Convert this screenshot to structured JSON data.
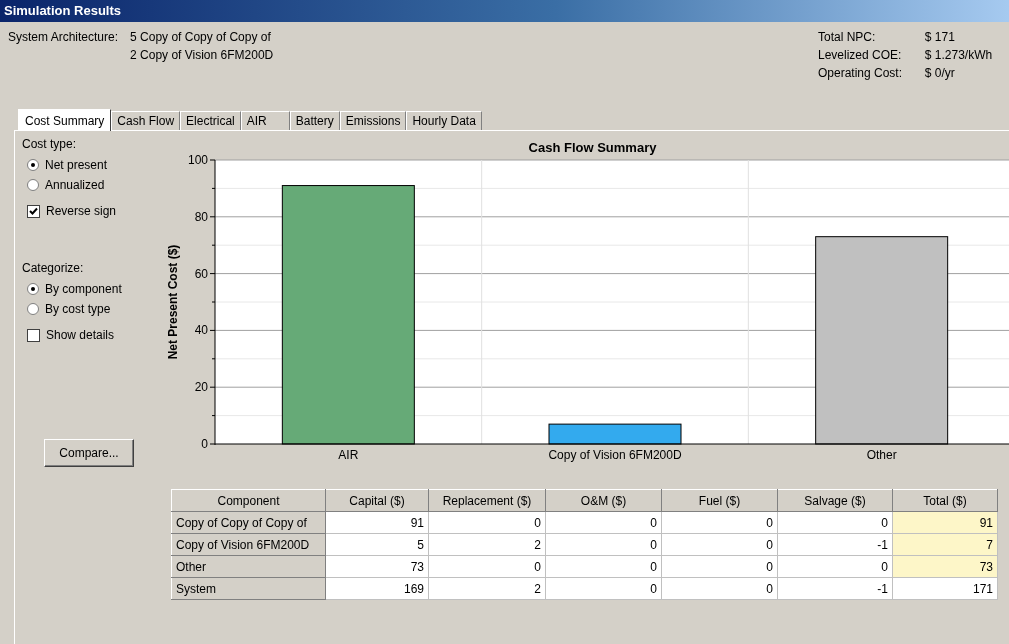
{
  "window": {
    "title": "Simulation Results"
  },
  "architecture": {
    "label": "System Architecture:",
    "lines": [
      "5 Copy of Copy of Copy of",
      "2 Copy of Vision 6FM200D"
    ]
  },
  "summary": [
    {
      "label": "Total NPC:",
      "value": "$ 171"
    },
    {
      "label": "Levelized COE:",
      "value": "$ 1.273/kWh"
    },
    {
      "label": "Operating Cost:",
      "value": "$ 0/yr"
    }
  ],
  "tabs": [
    {
      "label": "Cost Summary",
      "selected": true
    },
    {
      "label": "Cash Flow",
      "selected": false
    },
    {
      "label": "Electrical",
      "selected": false
    },
    {
      "label": "AIR",
      "selected": false
    },
    {
      "label": "Battery",
      "selected": false
    },
    {
      "label": "Emissions",
      "selected": false
    },
    {
      "label": "Hourly Data",
      "selected": false
    }
  ],
  "options": [
    {
      "kind": "heading",
      "label": "Cost type:"
    },
    {
      "kind": "radio",
      "label": "Net present",
      "selected": true
    },
    {
      "kind": "radio",
      "label": "Annualized",
      "selected": false
    },
    {
      "kind": "checkbox",
      "label": "Reverse sign",
      "checked": true
    },
    {
      "kind": "heading",
      "label": "Categorize:"
    },
    {
      "kind": "radio",
      "label": "By component",
      "selected": true
    },
    {
      "kind": "radio",
      "label": "By cost type",
      "selected": false
    },
    {
      "kind": "checkbox",
      "label": "Show details",
      "checked": false
    }
  ],
  "compare_button": "Compare...",
  "chart_data": {
    "type": "bar",
    "title": "Cash Flow Summary",
    "ylabel": "Net Present Cost ($)",
    "categories": [
      "AIR",
      "Copy of Vision 6FM200D",
      "Other"
    ],
    "values": [
      91,
      7,
      73
    ],
    "colors": [
      "#66aa77",
      "#33aaee",
      "#c0c0c0"
    ],
    "grid": true,
    "ylim": [
      0,
      100
    ],
    "yticks": [
      0,
      20,
      40,
      60,
      80,
      100
    ]
  },
  "table": {
    "columns": [
      "Component",
      "Capital ($)",
      "Replacement ($)",
      "O&M ($)",
      "Fuel ($)",
      "Salvage ($)",
      "Total ($)"
    ],
    "rows": [
      {
        "cells": [
          "Copy of Copy of Copy of",
          "91",
          "0",
          "0",
          "0",
          "0",
          "91"
        ],
        "total_highlighted": true
      },
      {
        "cells": [
          "Copy of Vision 6FM200D",
          "5",
          "2",
          "0",
          "0",
          "-1",
          "7"
        ],
        "total_highlighted": true
      },
      {
        "cells": [
          "Other",
          "73",
          "0",
          "0",
          "0",
          "0",
          "73"
        ],
        "total_highlighted": true
      },
      {
        "cells": [
          "System",
          "169",
          "2",
          "0",
          "0",
          "-1",
          "171"
        ],
        "total_highlighted": false
      }
    ]
  }
}
